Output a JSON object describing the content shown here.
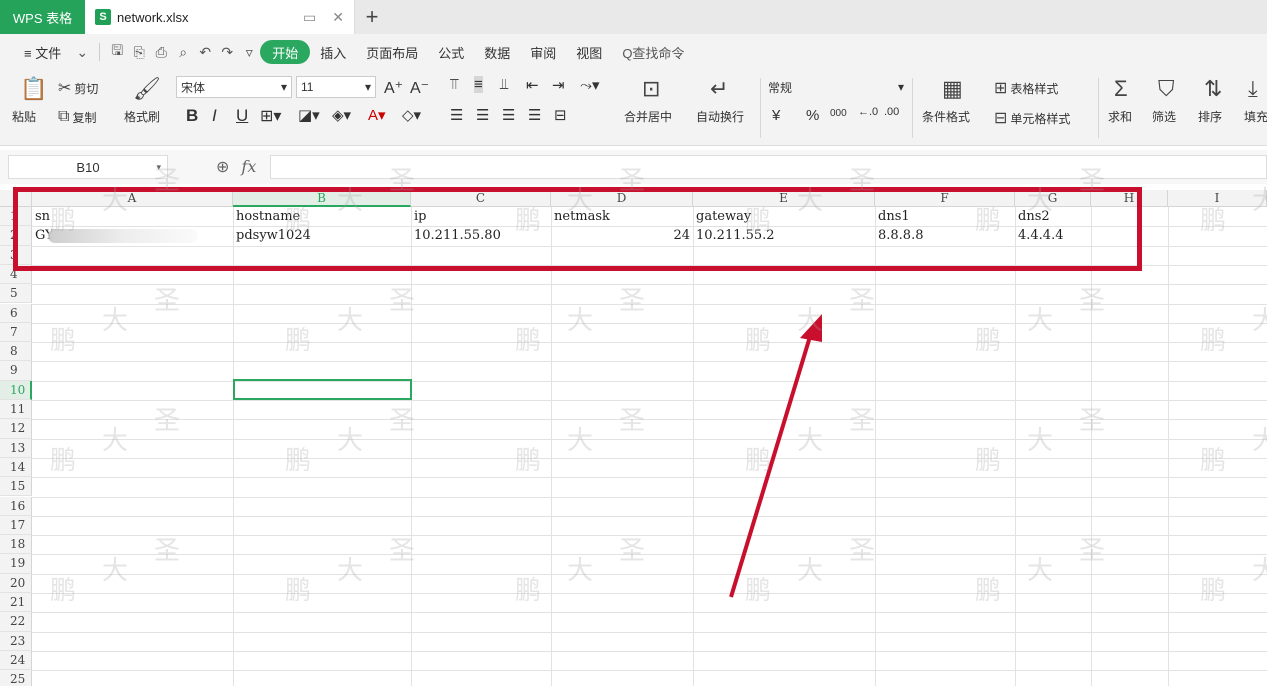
{
  "tabbar": {
    "app_label": "WPS 表格",
    "doc_icon": "S",
    "doc_name": "network.xlsx",
    "new_tab": "+"
  },
  "menu": {
    "file": "≡ 文件",
    "items": [
      "开始",
      "插入",
      "页面布局",
      "公式",
      "数据",
      "审阅",
      "视图"
    ],
    "active_index": 0,
    "search": "Q查找命令"
  },
  "ribbon": {
    "paste": "粘贴",
    "cut": "剪切",
    "copy": "复制",
    "format_painter": "格式刷",
    "font_name": "宋体",
    "font_size": "11",
    "bold": "B",
    "italic": "I",
    "underline": "U",
    "merge_center": "合并居中",
    "wrap_text": "自动换行",
    "number_format": "常规",
    "currency": "¥",
    "percent": "%",
    "thousands": "000",
    "cond_format": "条件格式",
    "table_style": "表格样式",
    "cell_style": "单元格样式",
    "sum": "求和",
    "filter": "筛选",
    "sort": "排序",
    "fill": "填充"
  },
  "formula": {
    "namebox": "B10",
    "fx": "fx",
    "content": ""
  },
  "sheet": {
    "columns": [
      "A",
      "B",
      "C",
      "D",
      "E",
      "F",
      "G",
      "H",
      "I"
    ],
    "selected_column": "B",
    "rows": [
      "1",
      "2",
      "3",
      "4",
      "5",
      "6",
      "7",
      "8",
      "9",
      "10",
      "11",
      "12",
      "13",
      "14",
      "15",
      "16",
      "17",
      "18",
      "19",
      "20",
      "21",
      "22",
      "23",
      "24",
      "25"
    ],
    "selected_row": "10",
    "row1": [
      "sn",
      "hostname",
      "ip",
      "netmask",
      "gateway",
      "dns1",
      "dns2"
    ],
    "row2": [
      "GY",
      "pdsyw1024",
      "10.211.55.80",
      "24",
      "10.211.55.2",
      "8.8.8.8",
      "4.4.4.4"
    ]
  },
  "watermark": [
    "鹏",
    "大",
    "圣"
  ],
  "colors": {
    "accent": "#2aa860",
    "app_tab": "#25a35a",
    "annotation": "#c8102e"
  }
}
